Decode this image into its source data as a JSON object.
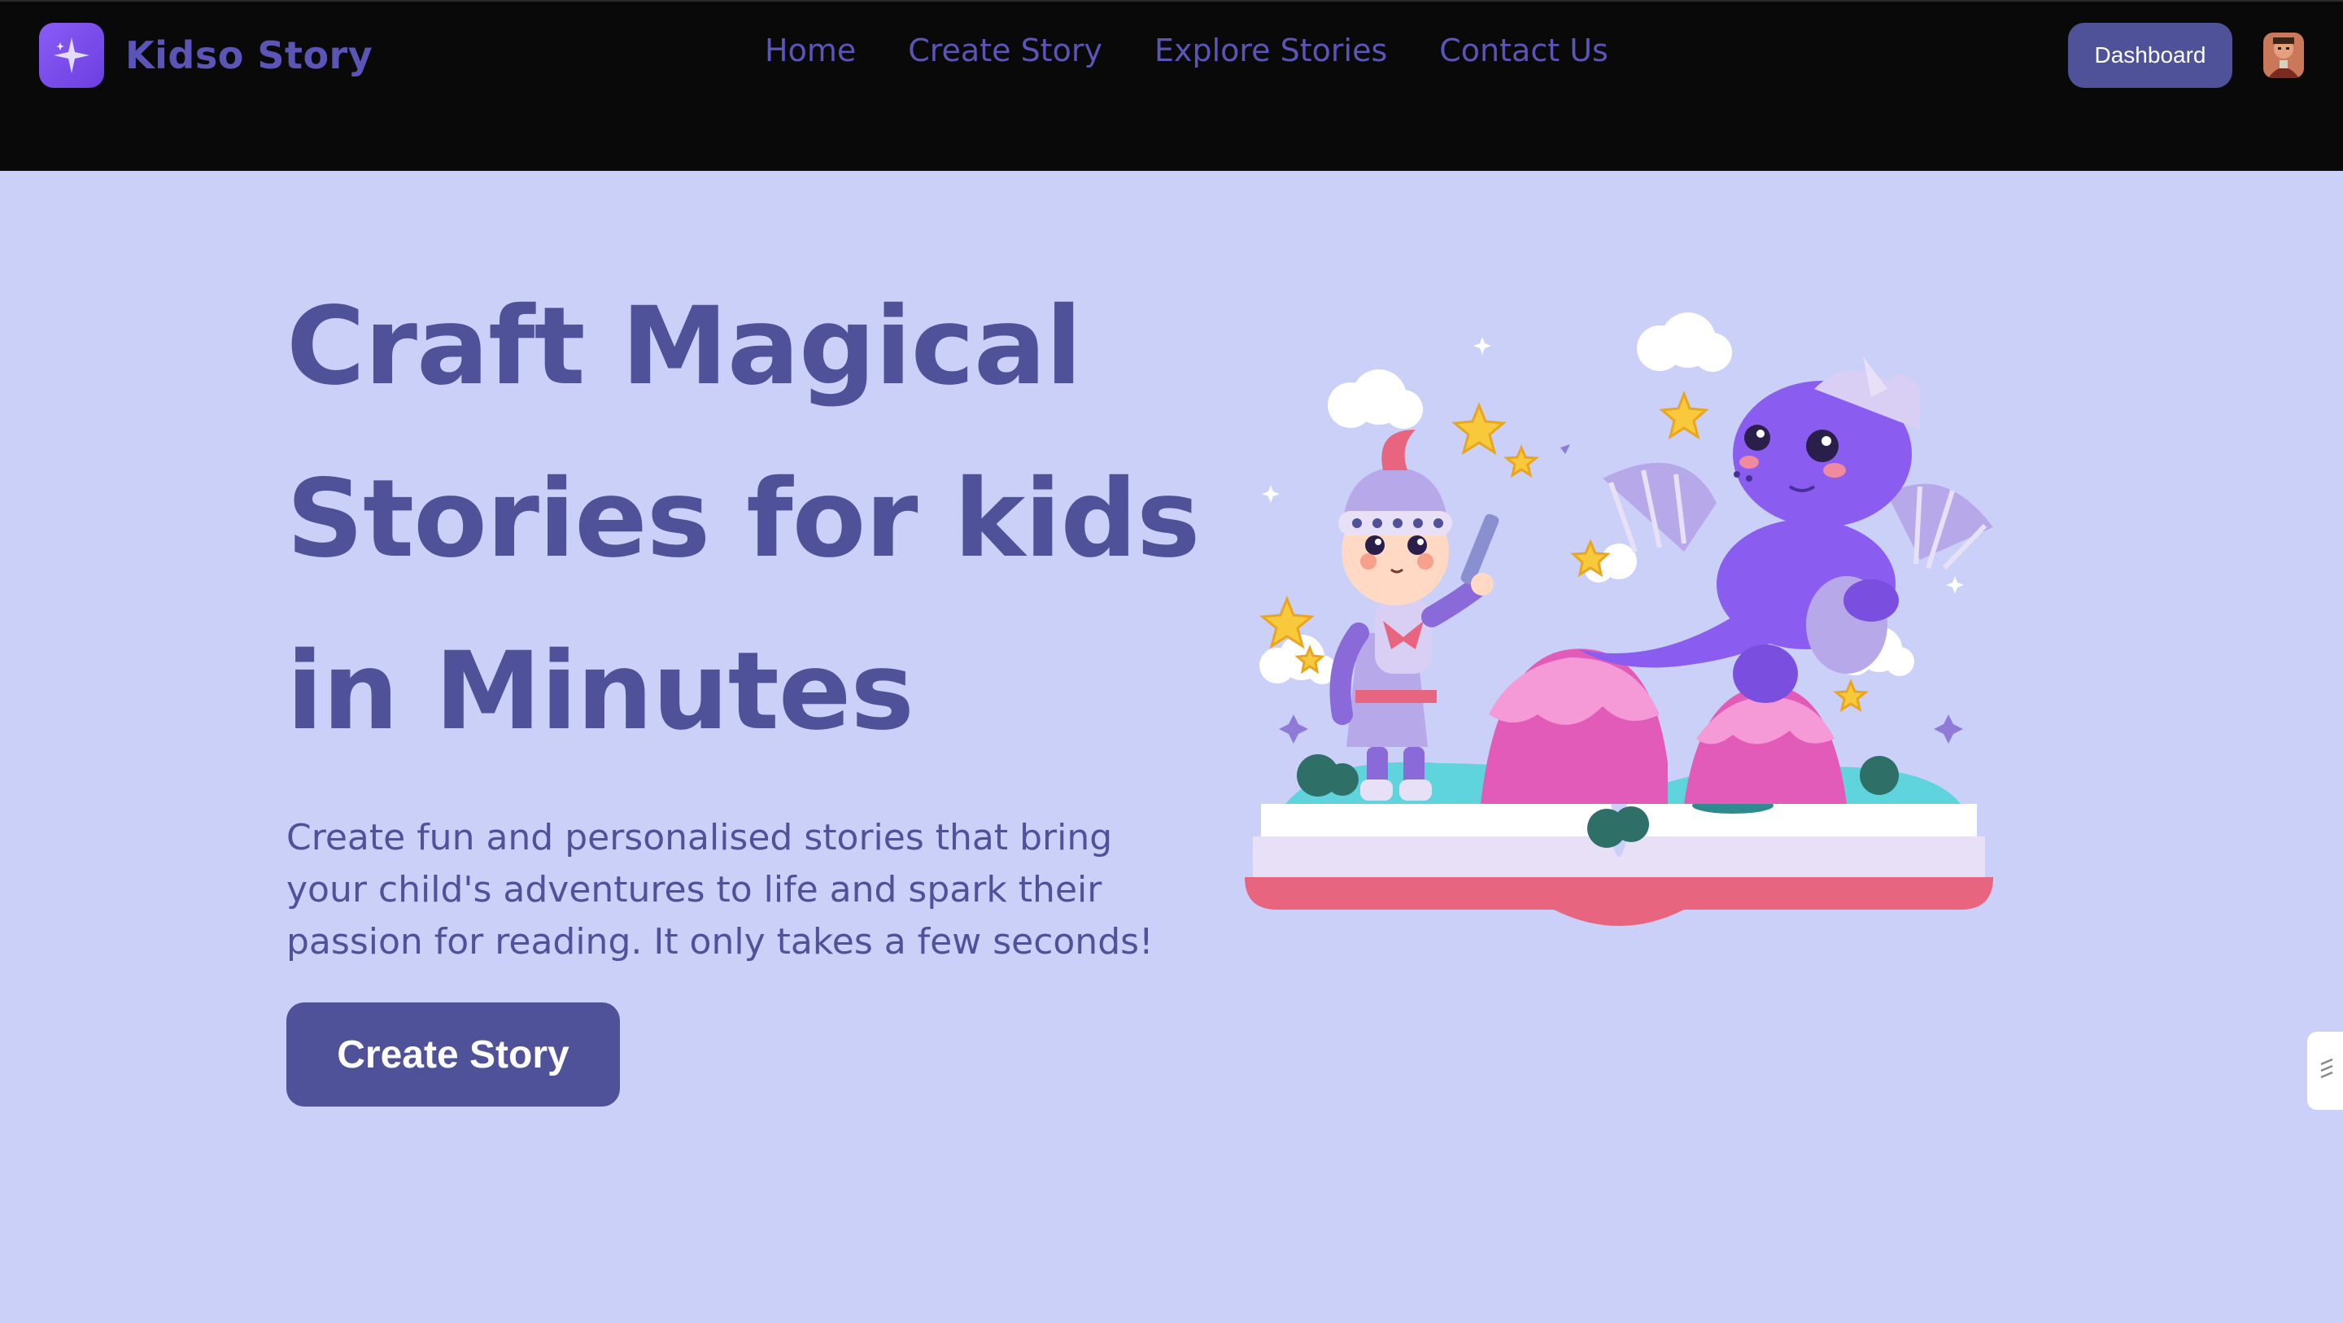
{
  "brand": {
    "name": "Kidso Story",
    "logo_icon": "sparkle-icon"
  },
  "nav": {
    "links": [
      "Home",
      "Create Story",
      "Explore Stories",
      "Contact Us"
    ],
    "dashboard_label": "Dashboard"
  },
  "hero": {
    "title_lines": [
      "Craft Magical",
      "Stories for kids",
      "in Minutes"
    ],
    "subtitle": "Create fun and personalised stories that bring your child's adventures to life and spark their passion for reading. It only takes a few seconds!",
    "cta_label": "Create Story"
  },
  "colors": {
    "nav_bg": "#090909",
    "page_bg": "#cbd0f9",
    "accent": "#4f5199",
    "link": "#5a55b6",
    "logo": "#7c4fe8"
  }
}
